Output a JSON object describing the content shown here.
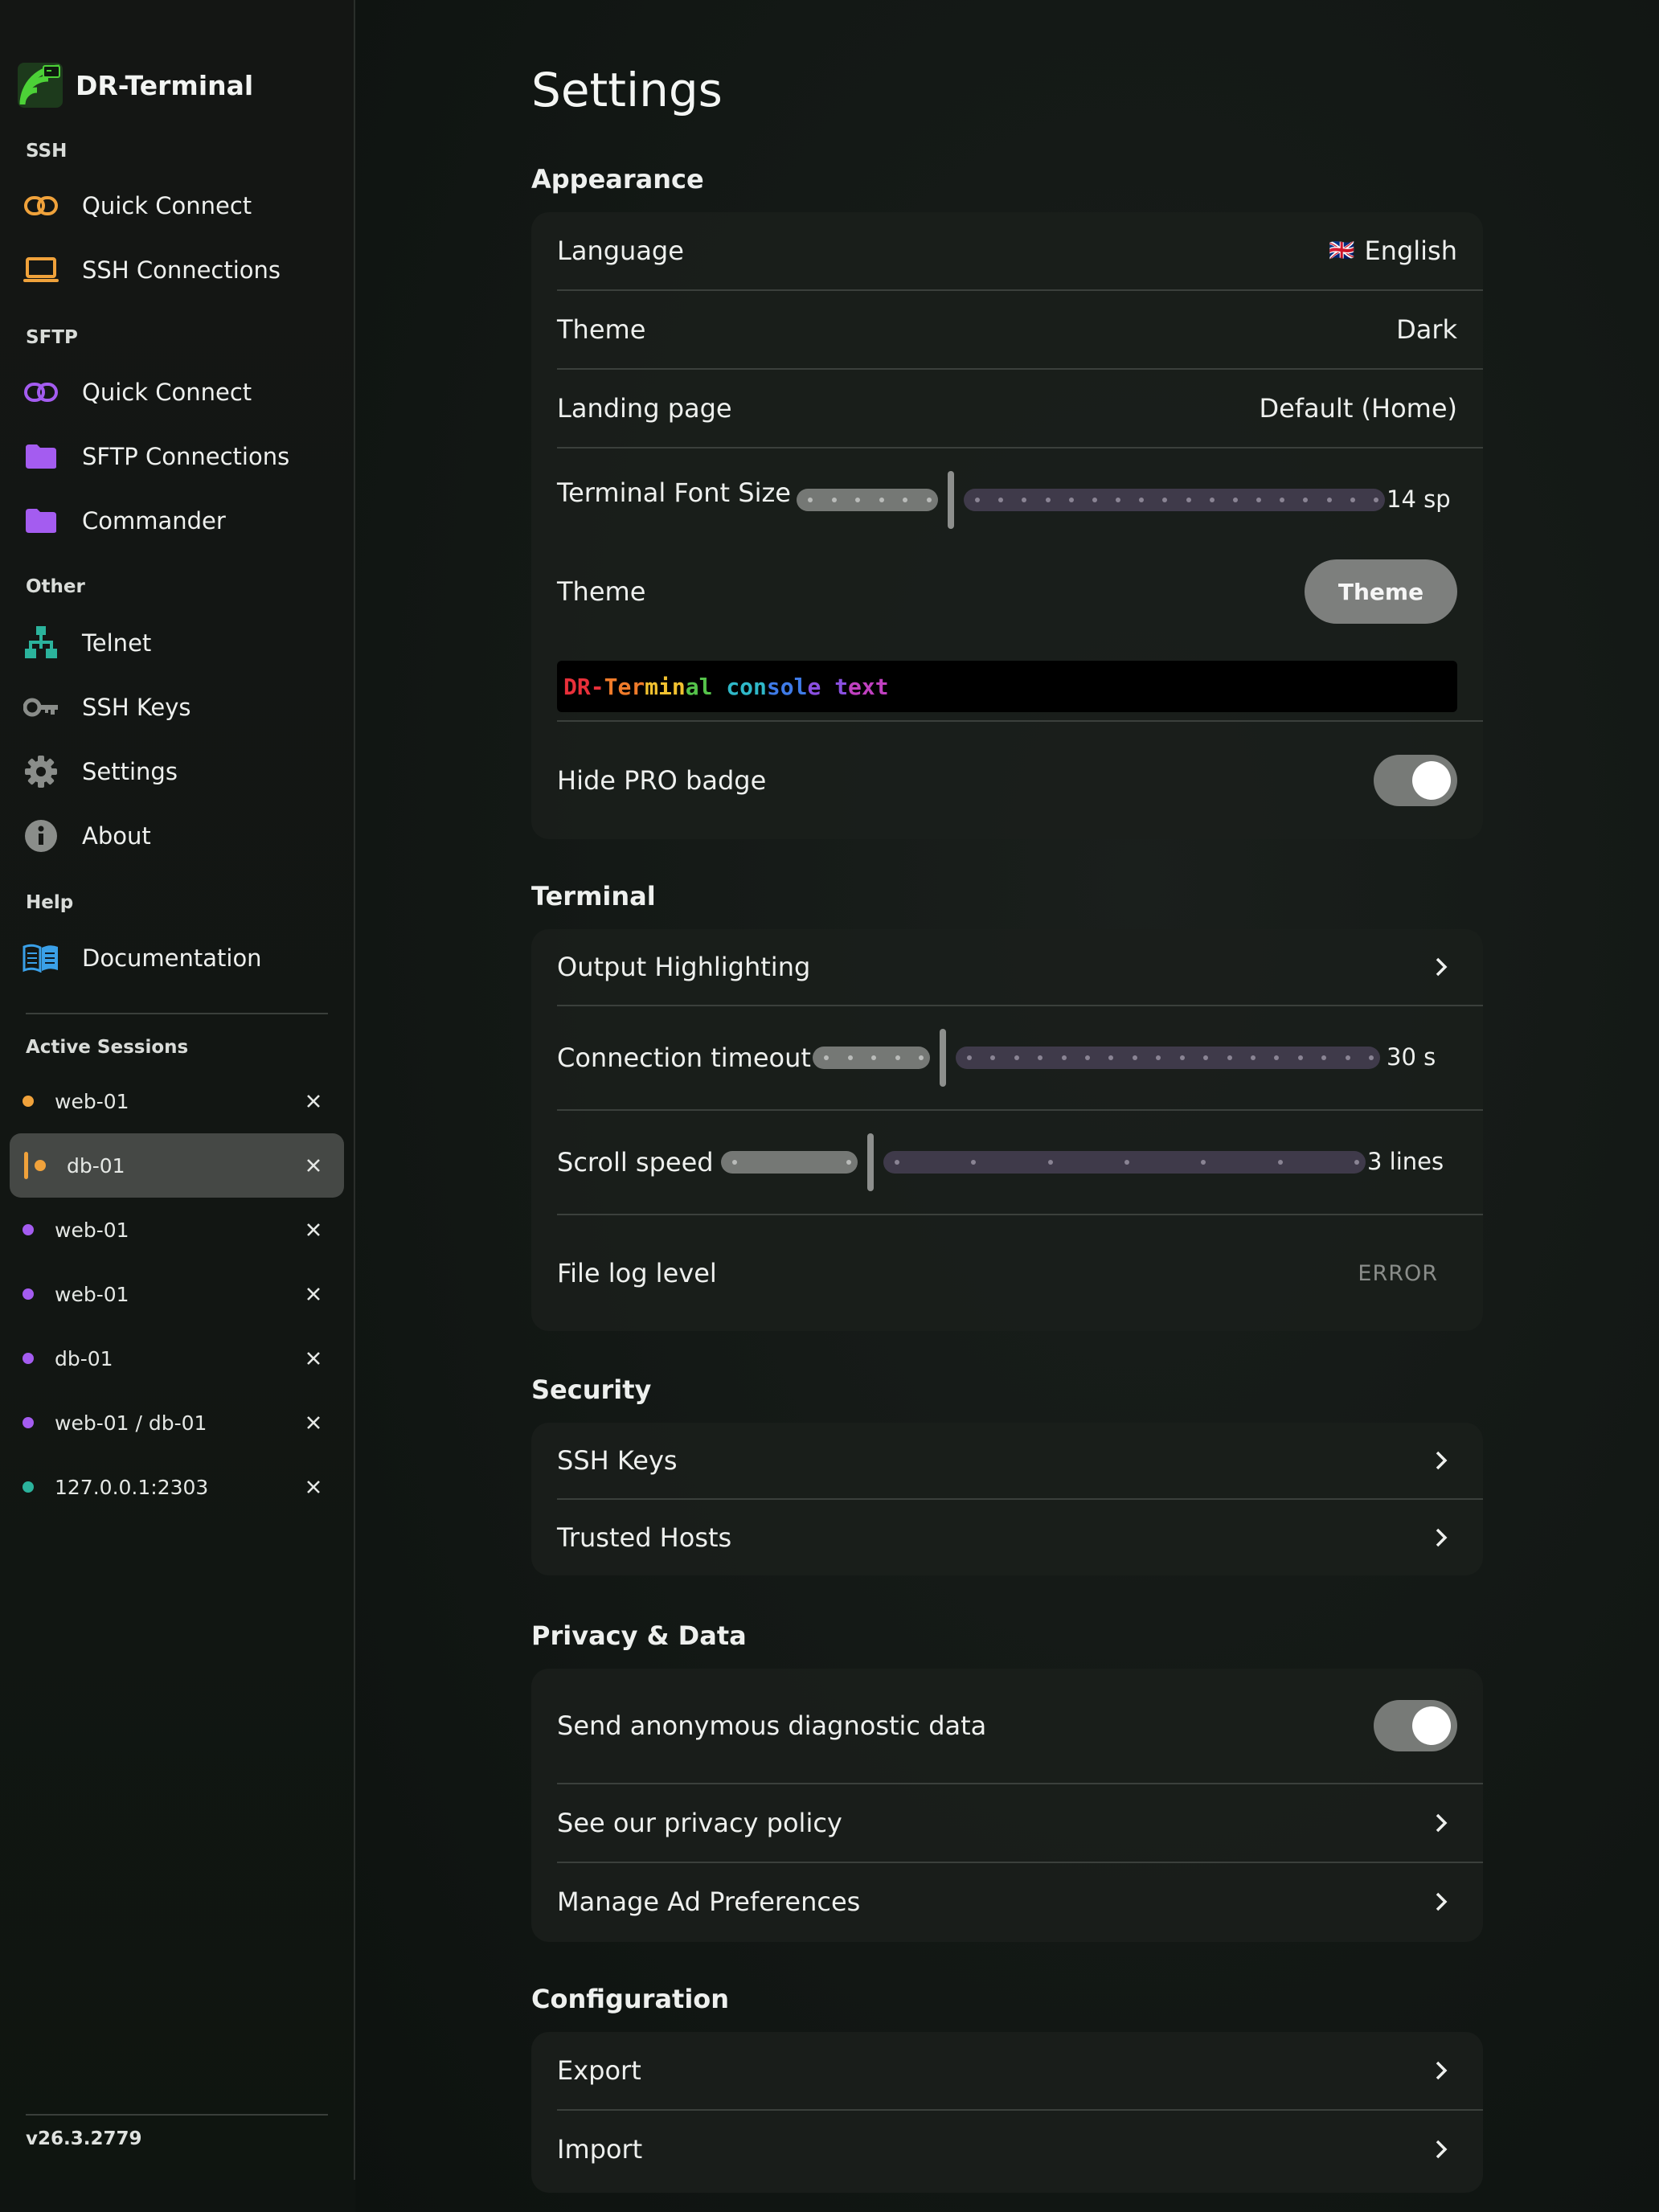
{
  "app": {
    "name": "DR-Terminal",
    "version": "v26.3.2779"
  },
  "colors": {
    "ssh": "#f0a23b",
    "sftp": "#a45cf0",
    "telnet": "#2bb39c",
    "docs": "#3aa0e8",
    "accent_green": "#4cd137"
  },
  "sidebar": {
    "sections": {
      "ssh": "SSH",
      "sftp": "SFTP",
      "other": "Other",
      "help": "Help",
      "active_sessions": "Active Sessions"
    },
    "items": {
      "ssh_quick": "Quick Connect",
      "ssh_connections": "SSH Connections",
      "sftp_quick": "Quick Connect",
      "sftp_connections": "SFTP Connections",
      "commander": "Commander",
      "telnet": "Telnet",
      "ssh_keys": "SSH Keys",
      "settings": "Settings",
      "about": "About",
      "documentation": "Documentation"
    },
    "sessions": [
      {
        "label": "web-01",
        "color": "#f0a23b"
      },
      {
        "label": "db-01",
        "color": "#f0a23b",
        "active": true
      },
      {
        "label": "web-01",
        "color": "#a45cf0"
      },
      {
        "label": "web-01",
        "color": "#a45cf0"
      },
      {
        "label": "db-01",
        "color": "#a45cf0"
      },
      {
        "label": "web-01 / db-01",
        "color": "#a45cf0"
      },
      {
        "label": "127.0.0.1:2303",
        "color": "#2bb39c"
      }
    ]
  },
  "settings": {
    "title": "Settings",
    "appearance": {
      "title": "Appearance",
      "language_label": "Language",
      "language_value": "English",
      "language_flag": "🇬🇧",
      "theme_label": "Theme",
      "theme_value": "Dark",
      "landing_label": "Landing page",
      "landing_value": "Default (Home)",
      "font_size_label": "Terminal Font Size",
      "font_size_value": "14 sp",
      "font_size_fraction": 0.25,
      "terminal_theme_label": "Theme",
      "terminal_theme_button": "Theme",
      "console_text": "DR-Terminal console text",
      "console_colors": [
        "#e8303a",
        "#f07b2a",
        "#f2c230",
        "#55c34a",
        "#2fb8c8",
        "#3f7be8",
        "#8a4fe0",
        "#c040c0"
      ],
      "hide_pro_label": "Hide PRO badge",
      "hide_pro_on": true
    },
    "terminal": {
      "title": "Terminal",
      "output_highlighting": "Output Highlighting",
      "timeout_label": "Connection timeout",
      "timeout_value": "30 s",
      "scroll_label": "Scroll speed",
      "scroll_value": "3 lines",
      "file_log_label": "File log level",
      "file_log_value": "ERROR"
    },
    "security": {
      "title": "Security",
      "ssh_keys": "SSH Keys",
      "trusted_hosts": "Trusted Hosts"
    },
    "privacy": {
      "title": "Privacy & Data",
      "diagnostic": "Send anonymous diagnostic data",
      "diagnostic_on": true,
      "privacy_policy": "See our privacy policy",
      "ad_prefs": "Manage Ad Preferences"
    },
    "configuration": {
      "title": "Configuration",
      "export": "Export",
      "import": "Import"
    }
  }
}
